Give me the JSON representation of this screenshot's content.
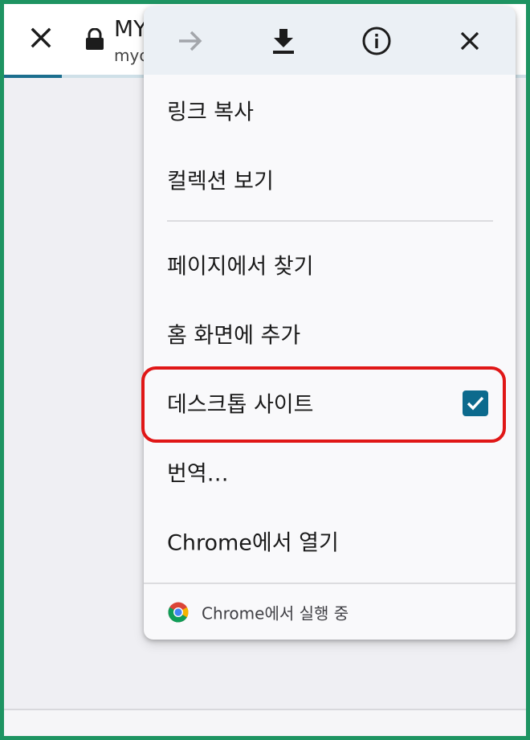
{
  "page": {
    "title": "MY",
    "url": "myc",
    "progress": 0.11
  },
  "menu": {
    "toolbar": [
      {
        "icon": "forward-arrow-icon",
        "enabled": false
      },
      {
        "icon": "download-icon",
        "enabled": true
      },
      {
        "icon": "info-icon",
        "enabled": true
      },
      {
        "icon": "close-icon",
        "enabled": true
      }
    ],
    "items": [
      {
        "label": "링크 복사"
      },
      {
        "label": "컬렉션 보기"
      },
      {
        "label": "페이지에서 찾기"
      },
      {
        "label": "홈 화면에 추가"
      },
      {
        "label": "데스크톱 사이트",
        "checked": true
      },
      {
        "label": "번역…"
      },
      {
        "label": "Chrome에서 열기"
      }
    ],
    "footer": {
      "text": "Chrome에서 실행 중",
      "icon": "chrome-icon"
    }
  },
  "colors": {
    "accent": "#0c6a8d",
    "highlight": "#e01717",
    "frame": "#1e9462"
  }
}
